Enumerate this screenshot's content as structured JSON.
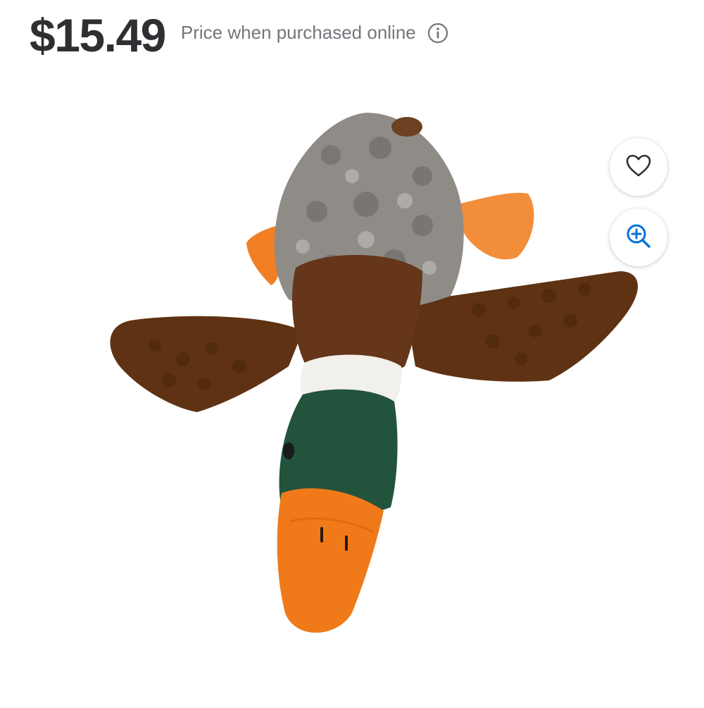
{
  "price": {
    "amount": "$15.49",
    "note": "Price when purchased online"
  },
  "icons": {
    "info": "info-icon",
    "favorite": "heart-outline-icon",
    "zoom": "zoom-in-icon"
  },
  "colors": {
    "price_text": "#2e2f32",
    "note_text": "#74767c",
    "zoom_icon": "#0071dc"
  }
}
